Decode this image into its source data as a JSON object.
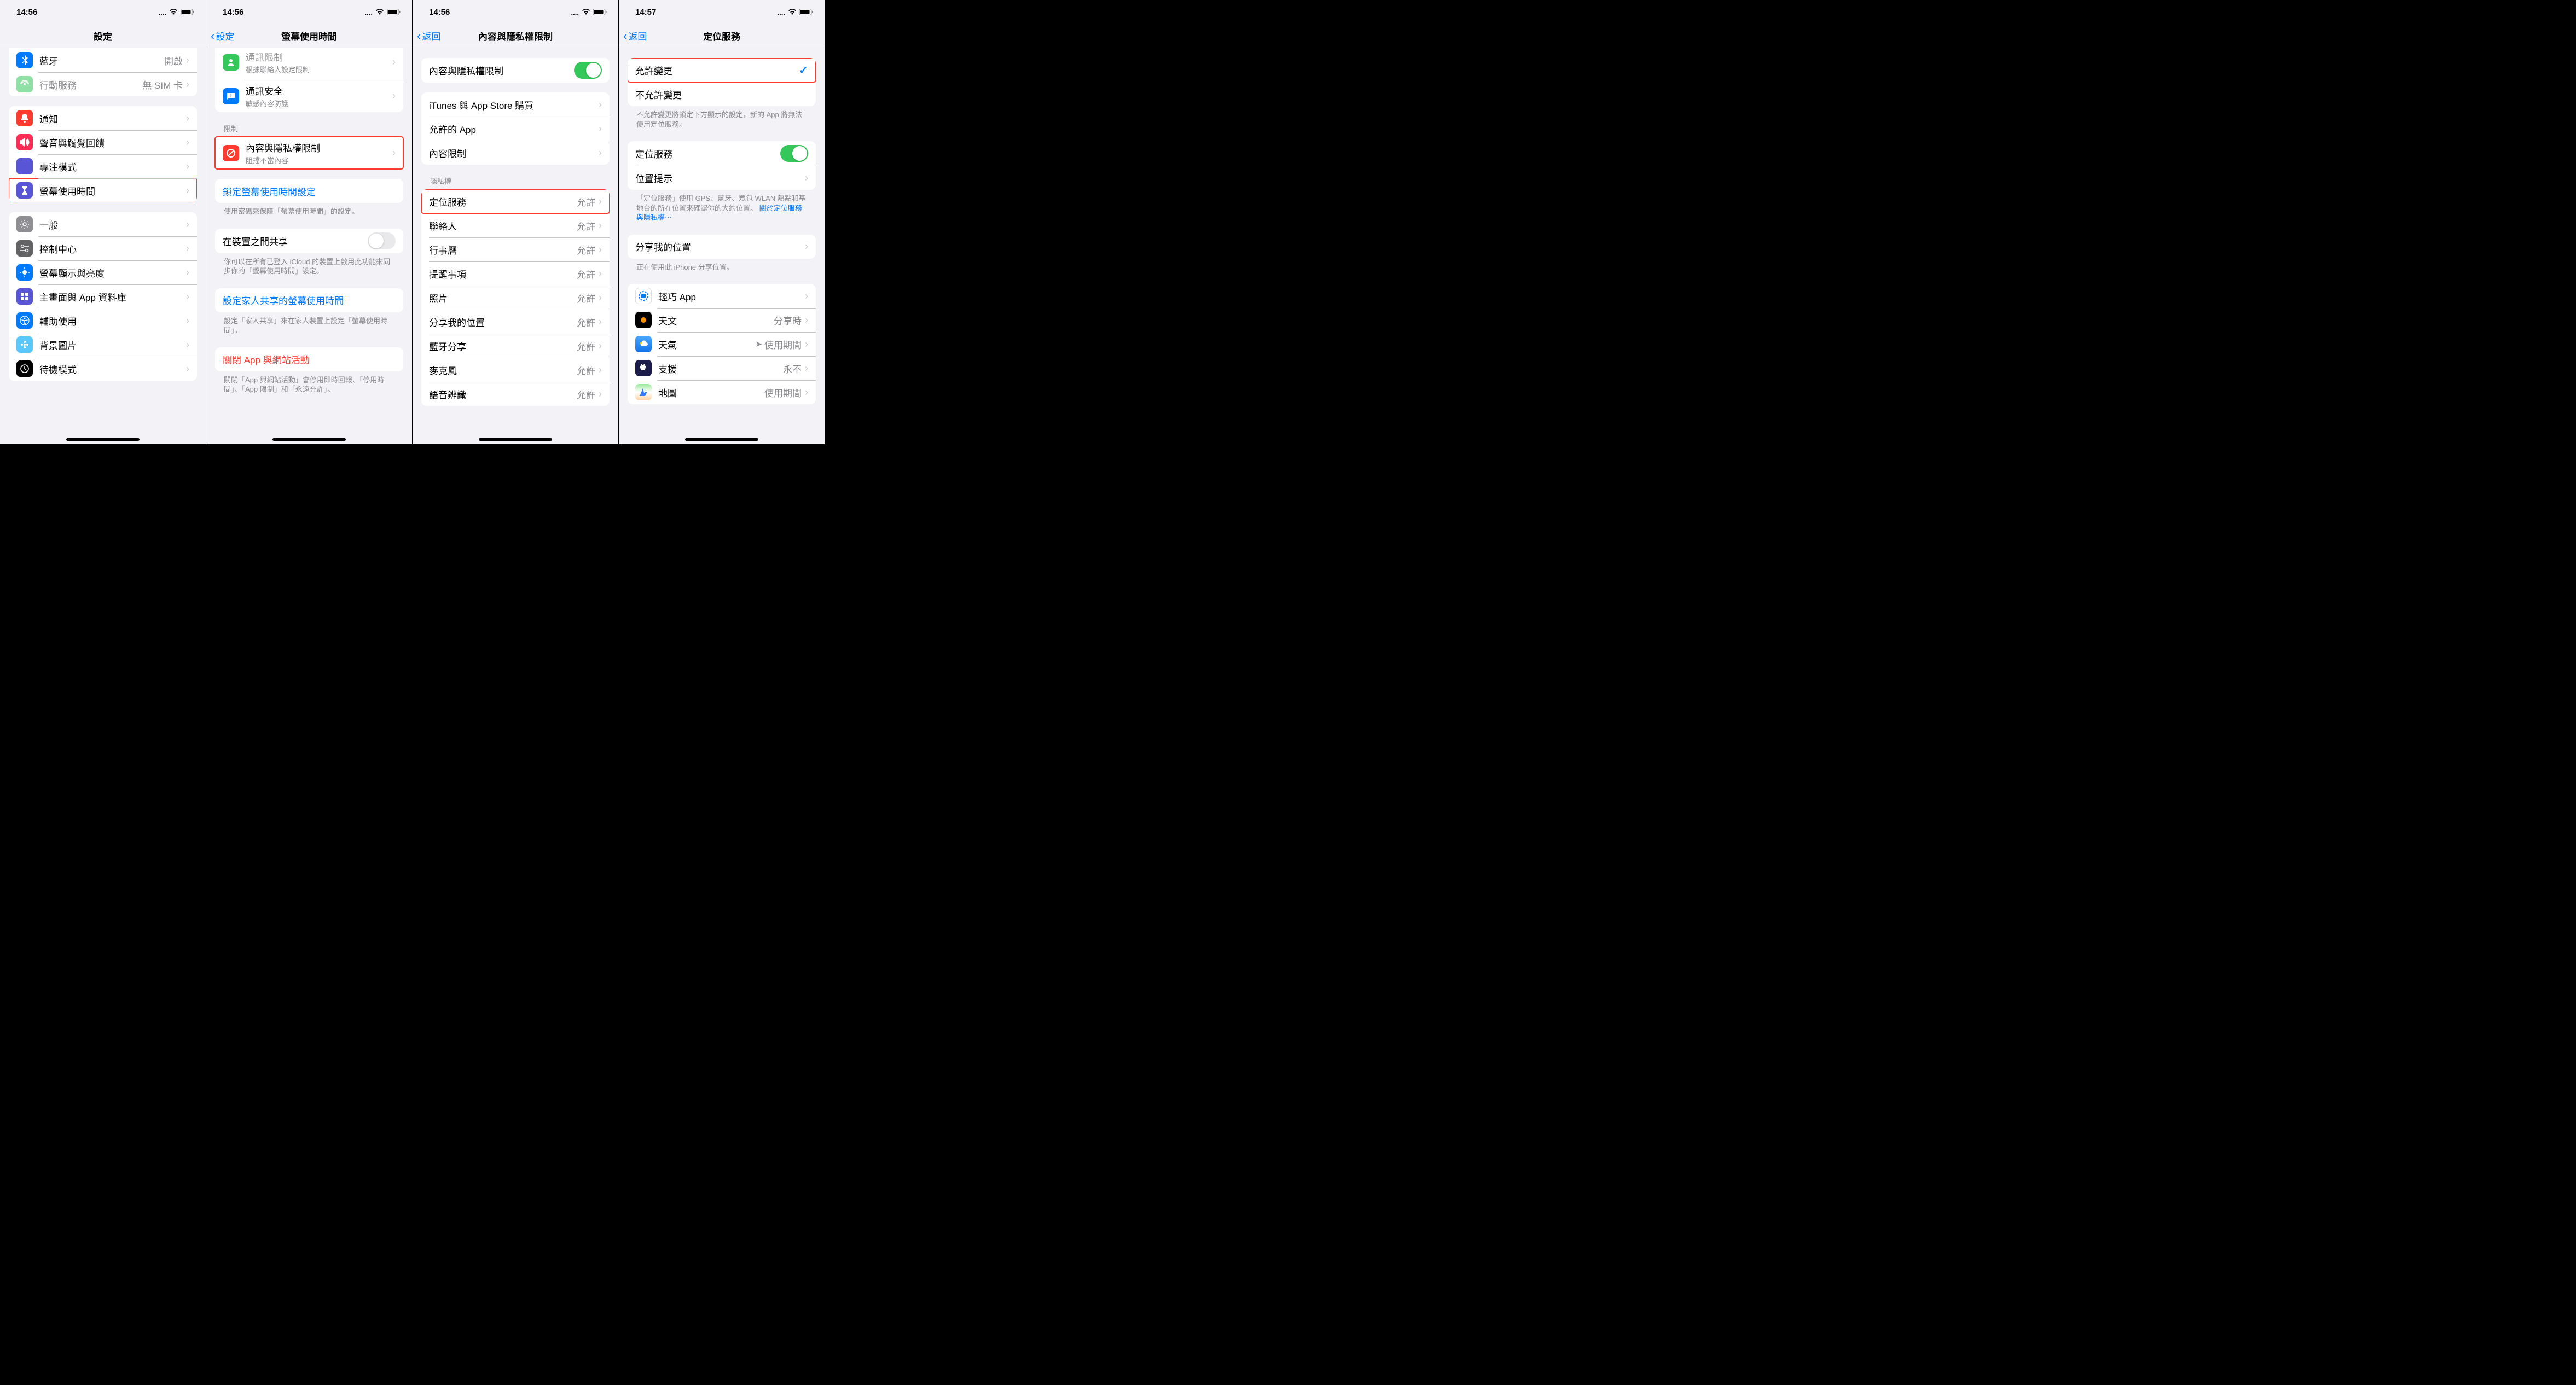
{
  "status": {
    "time1": "14:56",
    "time2": "14:56",
    "time3": "14:56",
    "time4": "14:57",
    "signal": "....",
    "wifi": "wifi",
    "battery": "battery"
  },
  "screen1": {
    "title": "設定",
    "items": {
      "bluetooth": {
        "label": "藍牙",
        "detail": "開啟"
      },
      "cellular": {
        "label": "行動服務",
        "detail": "無 SIM 卡"
      },
      "notifications": {
        "label": "通知"
      },
      "sound": {
        "label": "聲音與觸覺回饋"
      },
      "focus": {
        "label": "專注模式"
      },
      "screentime": {
        "label": "螢幕使用時間"
      },
      "general": {
        "label": "一般"
      },
      "controlcenter": {
        "label": "控制中心"
      },
      "display": {
        "label": "螢幕顯示與亮度"
      },
      "homescreen": {
        "label": "主畫面與 App 資料庫"
      },
      "accessibility": {
        "label": "輔助使用"
      },
      "wallpaper": {
        "label": "背景圖片"
      },
      "standby": {
        "label": "待機模式"
      }
    }
  },
  "screen2": {
    "back": "設定",
    "title": "螢幕使用時間",
    "comm_limit": {
      "label": "通訊限制",
      "sub": "根據聯絡人設定限制"
    },
    "comm_safety": {
      "label": "通訊安全",
      "sub": "敏感內容防護"
    },
    "restrict_header": "限制",
    "content_priv": {
      "label": "內容與隱私權限制",
      "sub": "阻擋不當內容"
    },
    "lock": {
      "label": "鎖定螢幕使用時間設定"
    },
    "lock_footer": "使用密碼來保障「螢幕使用時間」的設定。",
    "share": {
      "label": "在裝置之間共享"
    },
    "share_footer": "你可以在所有已登入 iCloud 的裝置上啟用此功能來同步你的「螢幕使用時間」設定。",
    "family": {
      "label": "設定家人共享的螢幕使用時間"
    },
    "family_footer": "設定「家人共享」來在家人裝置上設定「螢幕使用時間」。",
    "turnoff": {
      "label": "關閉 App 與網站活動"
    },
    "turnoff_footer": "關閉「App 與網站活動」會停用即時回報、「停用時間」、「App 限制」和「永遠允許」。"
  },
  "screen3": {
    "back": "返回",
    "title": "內容與隱私權限制",
    "master": {
      "label": "內容與隱私權限制"
    },
    "itunes": {
      "label": "iTunes 與 App Store 購買"
    },
    "allowed_apps": {
      "label": "允許的 App"
    },
    "content_restrict": {
      "label": "內容限制"
    },
    "privacy_header": "隱私權",
    "location": {
      "label": "定位服務",
      "detail": "允許"
    },
    "contacts": {
      "label": "聯絡人",
      "detail": "允許"
    },
    "calendar": {
      "label": "行事曆",
      "detail": "允許"
    },
    "reminders": {
      "label": "提醒事項",
      "detail": "允許"
    },
    "photos": {
      "label": "照片",
      "detail": "允許"
    },
    "share_loc": {
      "label": "分享我的位置",
      "detail": "允許"
    },
    "bt_share": {
      "label": "藍牙分享",
      "detail": "允許"
    },
    "mic": {
      "label": "麥克風",
      "detail": "允許"
    },
    "speech": {
      "label": "語音辨識",
      "detail": "允許"
    }
  },
  "screen4": {
    "back": "返回",
    "title": "定位服務",
    "allow_change": {
      "label": "允許變更"
    },
    "disallow_change": {
      "label": "不允許變更"
    },
    "change_footer": "不允許變更將鎖定下方顯示的設定，新的 App 將無法使用定位服務。",
    "loc_services": {
      "label": "定位服務"
    },
    "loc_alerts": {
      "label": "位置提示"
    },
    "loc_footer": "「定位服務」使用 GPS、藍牙、眾包 WLAN 熱點和基地台的所在位置來確認你的大約位置。",
    "loc_footer_link": "關於定位服務與隱私權⋯",
    "share_my_loc": {
      "label": "分享我的位置"
    },
    "share_footer": "正在使用此 iPhone 分享位置。",
    "app_clips": {
      "label": "輕巧 App"
    },
    "astronomy": {
      "label": "天文",
      "detail": "分享時"
    },
    "weather": {
      "label": "天氣",
      "detail": "使用期間"
    },
    "support": {
      "label": "支援",
      "detail": "永不"
    },
    "maps": {
      "label": "地圖",
      "detail": "使用期間"
    }
  }
}
